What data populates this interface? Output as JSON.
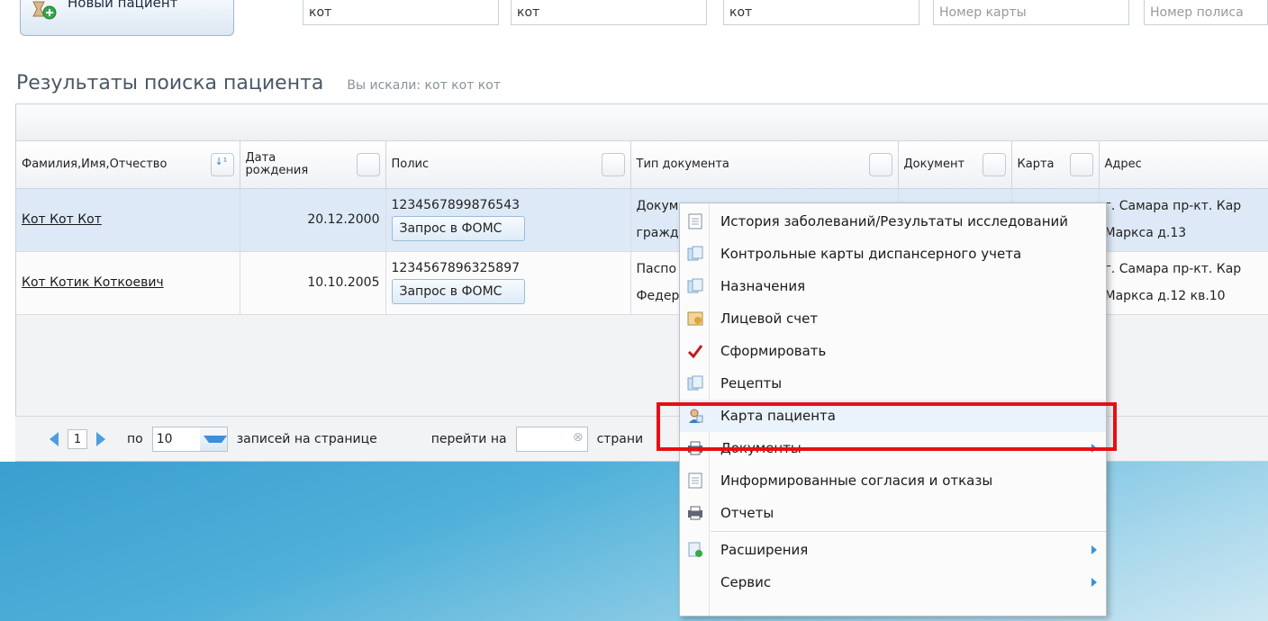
{
  "toolbar": {
    "new_patient_label": "Новый пациент",
    "search_last_name": "кот",
    "search_first_name": "кот",
    "search_middle_name": "кот",
    "card_number_placeholder": "Номер карты",
    "policy_number_placeholder": "Номер полиса"
  },
  "results": {
    "title": "Результаты поиска пациента",
    "query_text": "Вы искали: кот кот кот"
  },
  "grid": {
    "columns": {
      "fio": "Фамилия,Имя,Отчество",
      "birth_date": "Дата рождения",
      "policy": "Полис",
      "doc_type": "Тип документа",
      "document": "Документ",
      "card": "Карта",
      "address": "Адрес"
    },
    "rows": [
      {
        "fio": "Кот Кот Кот",
        "birth_date": "20.12.2000",
        "policy": "1234567899876543",
        "foms_button": "Запрос в ФОМС",
        "doc_type_line1": "Докум",
        "doc_type_line2": "гражд",
        "address_line1": "г. Самара пр-кт. Кар",
        "address_line2": "Маркса д.13"
      },
      {
        "fio": "Кот Котик Коткоевич",
        "birth_date": "10.10.2005",
        "policy": "1234567896325897",
        "foms_button": "Запрос в ФОМС",
        "doc_type_line1": "Паспо",
        "doc_type_line2": "Федер",
        "address_line1": "г. Самара пр-кт. Кар",
        "address_line2": "Маркса д.12 кв.10"
      }
    ]
  },
  "pager": {
    "current_page": "1",
    "per_page_prefix": "по",
    "per_page_value": "10",
    "per_page_suffix": "записей на странице",
    "goto_label": "перейти на",
    "page_suffix": "страни"
  },
  "context_menu": {
    "items": [
      {
        "label": "История заболеваний/Результаты исследований",
        "icon": "history-icon",
        "submenu": false
      },
      {
        "label": "Контрольные карты диспансерного учета",
        "icon": "control-cards-icon",
        "submenu": false
      },
      {
        "label": "Назначения",
        "icon": "prescriptions-icon",
        "submenu": false
      },
      {
        "label": "Лицевой счет",
        "icon": "account-icon",
        "submenu": false
      },
      {
        "label": "Сформировать",
        "icon": "checkmark-icon",
        "submenu": false
      },
      {
        "label": "Рецепты",
        "icon": "recipes-icon",
        "submenu": false
      },
      {
        "label": "Карта пациента",
        "icon": "patient-card-icon",
        "submenu": false,
        "highlighted": true
      },
      {
        "label": "Документы",
        "icon": "printer-icon",
        "submenu": true
      },
      {
        "label": "Информированные согласия и отказы",
        "icon": "consent-icon",
        "submenu": false
      },
      {
        "label": "Отчеты",
        "icon": "printer-icon",
        "submenu": false
      },
      {
        "label": "Расширения",
        "icon": "extensions-icon",
        "submenu": true
      },
      {
        "label": "Сервис",
        "icon": "",
        "submenu": true
      }
    ],
    "highlight_color": "#e60f14"
  }
}
